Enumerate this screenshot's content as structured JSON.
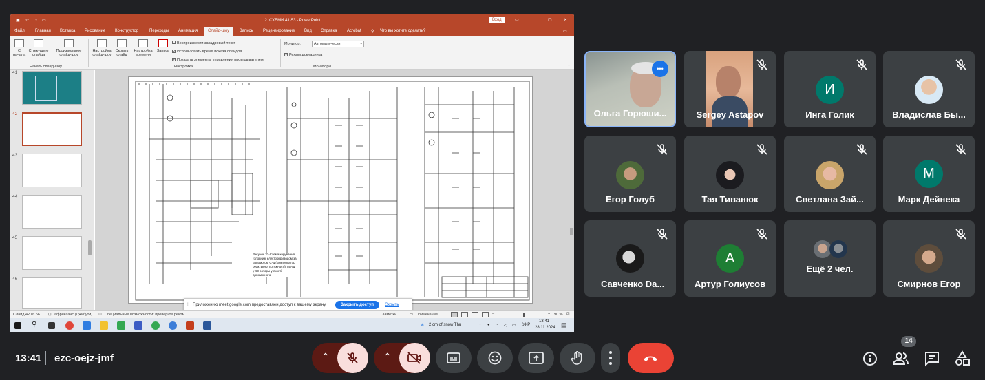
{
  "ppt": {
    "window_title": "2. СХЕМИ  41-53  -  PowerPoint",
    "signin": "Вход",
    "tabs": [
      "Файл",
      "Главная",
      "Вставка",
      "Рисование",
      "Конструктор",
      "Переходы",
      "Анимация",
      "Слайд-шоу",
      "Запись",
      "Рецензирование",
      "Вид",
      "Справка",
      "Acrobat"
    ],
    "tell_me": "Что вы хотите сделать?",
    "ribbon": {
      "from_start": "С начала",
      "from_current": "С текущего слайда",
      "custom": "Произвольное слайд-шоу",
      "group_start": "Начать слайд-шоу",
      "setup": "Настройка слайд-шоу",
      "hide": "Скрыть слайд",
      "rehearse": "Настройка времени",
      "record": "Запись",
      "chk1": "Воспроизвести закадровый текст",
      "chk2": "Использовать время показа слайдов",
      "chk3": "Показать элементы управления проигрывателем",
      "group_setup": "Настройка",
      "monitor_label": "Монитор:",
      "monitor_value": "Автоматически",
      "presenter": "Режим докладчика",
      "group_monitors": "Мониторы"
    },
    "slide_numbers": [
      "41",
      "42",
      "43",
      "44",
      "45",
      "46"
    ],
    "caption": "Рисунок 31-Схема керування головним електроприводом за допомогою С-Д (компенсатор реактивної потужності) та АД у КЗ роторы у якості допоміжного",
    "notification": {
      "text": "Приложению meet.google.com предоставлен доступ к вашему экрану.",
      "stop": "Закрыть доступ",
      "hide": "Скрыть"
    },
    "status": {
      "slide": "Слайд 42 из 56",
      "lang": "африкаанс (Джибути)",
      "accessibility": "Специальные возможности: проверьте рекомендации",
      "notes": "Заметки",
      "comments": "Примечания",
      "zoom": "90 %"
    },
    "taskbar": {
      "weather": "2 cm of snow  Thu",
      "lang": "УКР",
      "time": "13:41",
      "date": "28.11.2024"
    }
  },
  "participants": [
    {
      "name": "Ольга Горюши...",
      "type": "video",
      "more_label": "•••"
    },
    {
      "name": "Sergey Astapov",
      "type": "video"
    },
    {
      "name": "Инга Голик",
      "initial": "И",
      "color": "#00796b"
    },
    {
      "name": "Владислав Бы...",
      "type": "photo"
    },
    {
      "name": "Егор Голуб",
      "type": "photo"
    },
    {
      "name": "Тая Тиванюк",
      "type": "photo"
    },
    {
      "name": "Светлана Зай...",
      "type": "photo"
    },
    {
      "name": "Марк Дейнека",
      "initial": "М",
      "color": "#00796b"
    },
    {
      "name": "_Савченко Da...",
      "type": "photo"
    },
    {
      "name": "Артур Голиусов",
      "initial": "А",
      "color": "#1e7e34"
    },
    {
      "name": "Ещё 2 чел.",
      "type": "group"
    },
    {
      "name": "Смирнов Егор",
      "type": "photo"
    }
  ],
  "meeting": {
    "time": "13:41",
    "code": "ezc-oejz-jmf",
    "people_count": "14"
  },
  "colors": {
    "ppt_accent": "#b7472a",
    "end_call": "#ea4335",
    "muted_control": "#f9dedc",
    "tile_bg": "#3c4043",
    "active_border": "#8ab4f8"
  }
}
